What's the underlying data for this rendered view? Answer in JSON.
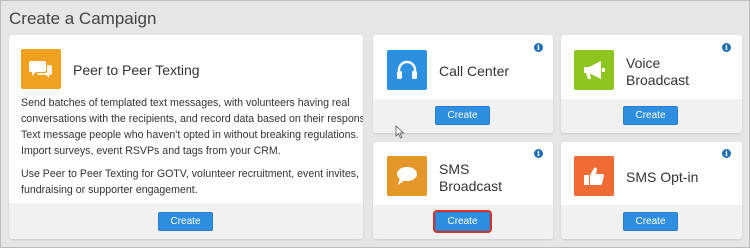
{
  "page": {
    "title": "Create a Campaign"
  },
  "colors": {
    "accent_button": "#2e8ee0",
    "peer_to_peer": "#f0a21e",
    "call_center": "#2c8fe0",
    "voice_broadcast": "#8ec51f",
    "sms_broadcast": "#e5982a",
    "sms_optin": "#f06b33",
    "highlight": "#d6332b"
  },
  "cards": {
    "peer": {
      "title": "Peer to Peer Texting",
      "icon": "chat-bubbles-icon",
      "paragraph1": "Send batches of templated text messages, with volunteers having real conversations with the recipients, and record data based on their responses. Text message people who haven't opted in without breaking regulations. Import surveys, event RSVPs and tags from your CRM.",
      "paragraph2": "Use Peer to Peer Texting for GOTV, volunteer recruitment, event invites, fundraising or supporter engagement.",
      "button": "Create"
    },
    "call_center": {
      "title": "Call Center",
      "icon": "headset-icon",
      "info": "i",
      "button": "Create"
    },
    "voice_broadcast": {
      "title_line1": "Voice",
      "title_line2": "Broadcast",
      "icon": "megaphone-icon",
      "info": "i",
      "button": "Create"
    },
    "sms_broadcast": {
      "title_line1": "SMS",
      "title_line2": "Broadcast",
      "icon": "speech-bubble-icon",
      "info": "i",
      "button": "Create",
      "highlighted": true
    },
    "sms_optin": {
      "title": "SMS Opt-in",
      "icon": "thumbs-up-icon",
      "info": "i",
      "button": "Create"
    }
  }
}
